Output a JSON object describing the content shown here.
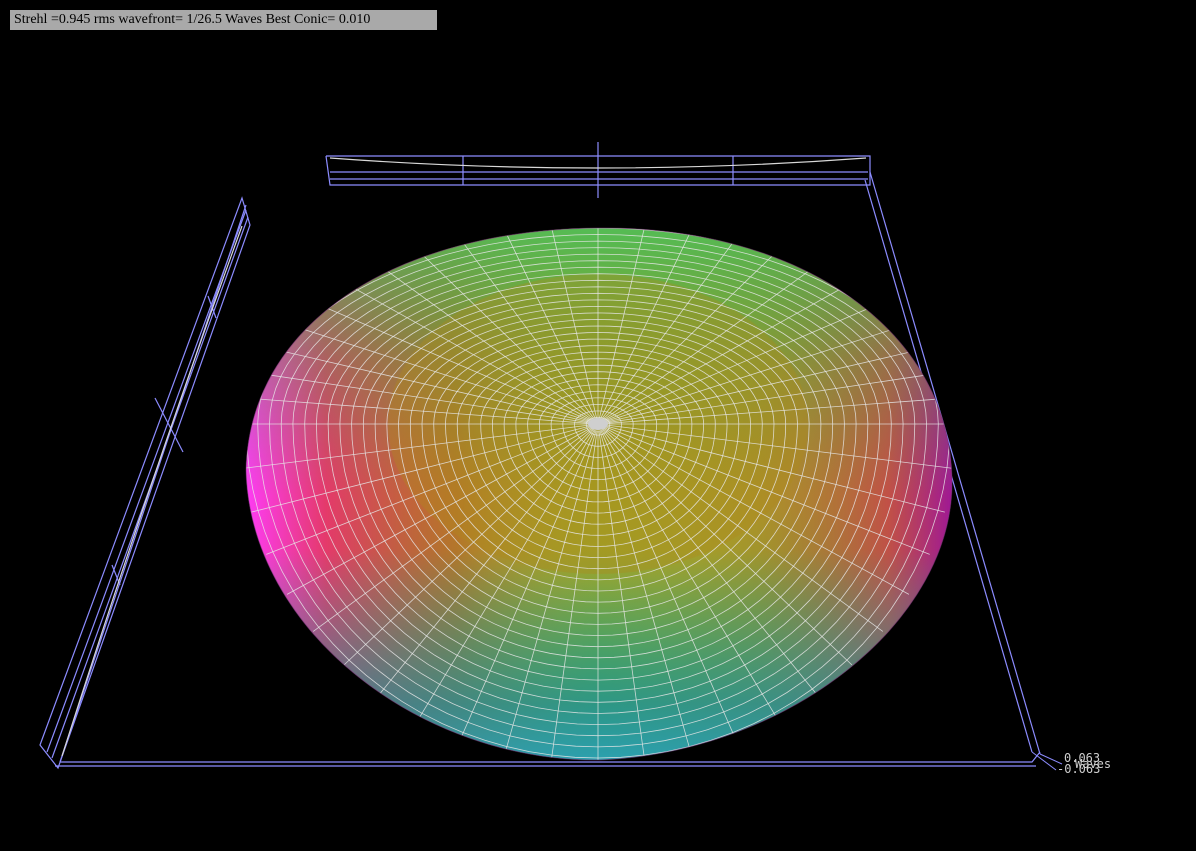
{
  "status": {
    "strehl_text": "Strehl =0.945 rms wavefront= 1/26.5 Waves Best Conic= 0.010"
  },
  "plot": {
    "scale_upper": "0.063",
    "scale_unit": "Waves",
    "scale_lower": "-0.063",
    "background_color": "#000000",
    "box_color": "#8c8cff",
    "mesh_color": "#e6e6e6"
  }
}
